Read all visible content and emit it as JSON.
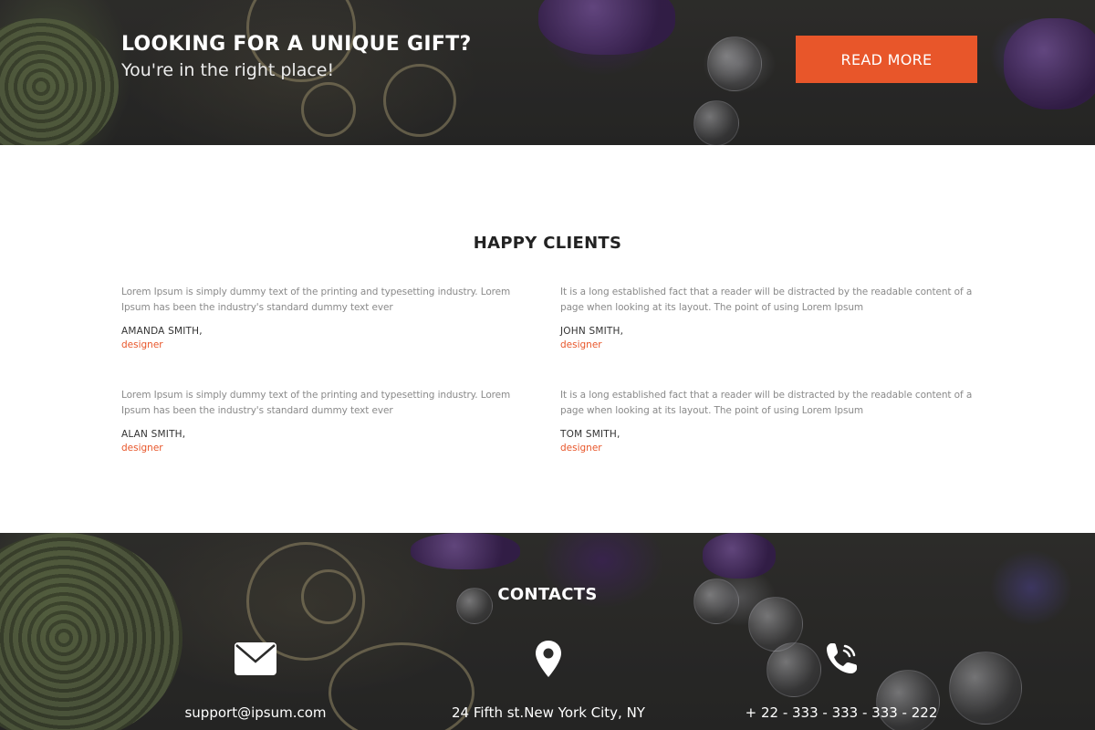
{
  "hero": {
    "title": "LOOKING FOR A UNIQUE GIFT?",
    "subtitle": "You're in the right place!",
    "button_label": "READ MORE"
  },
  "clients": {
    "title": "HAPPY CLIENTS",
    "items": [
      {
        "quote": "Lorem Ipsum is simply dummy text of the printing and typesetting industry. Lorem Ipsum has been the industry's standard dummy text ever",
        "name": "AMANDA SMITH,",
        "role": "designer"
      },
      {
        "quote": "It is a long established fact that a reader will be distracted by the readable content of a page when looking at its layout. The point of using Lorem Ipsum",
        "name": "JOHN SMITH,",
        "role": "designer"
      },
      {
        "quote": "Lorem Ipsum is simply dummy text of the printing and typesetting industry. Lorem Ipsum has been the industry's standard dummy text ever",
        "name": "ALAN SMITH,",
        "role": "designer"
      },
      {
        "quote": "It is a long established fact that a reader will be distracted by the readable content of a page when looking at its layout. The point of using Lorem Ipsum",
        "name": "TOM SMITH,",
        "role": "designer"
      }
    ]
  },
  "contacts": {
    "title": "CONTACTS",
    "email": "support@ipsum.com",
    "address": "24 Fifth st.New York City, NY",
    "phone": "+ 22 - 333 - 333 - 333 - 222",
    "icons": [
      "envelope-icon",
      "map-pin-icon",
      "phone-icon"
    ]
  },
  "colors": {
    "accent": "#e8562a",
    "dark_bg": "#2b2b2a",
    "quote_text": "#8a8a8a"
  }
}
